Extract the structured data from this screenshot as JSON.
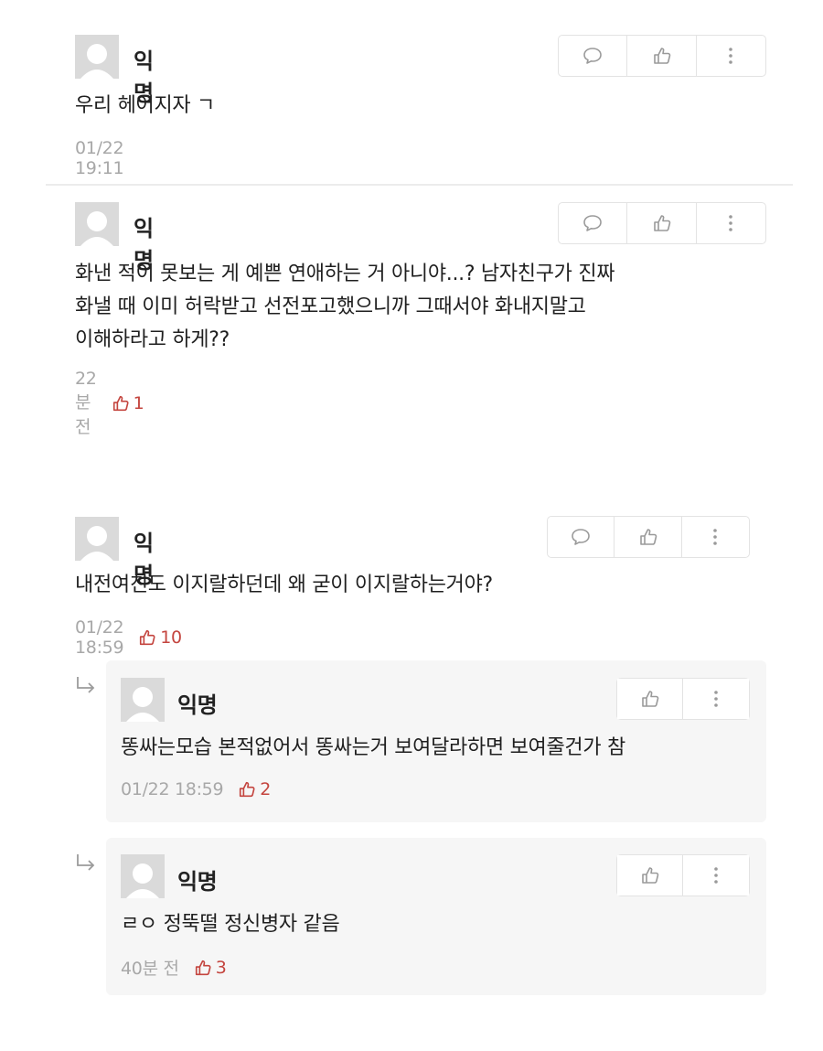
{
  "comments": [
    {
      "author": "익명",
      "lines": [
        "우리 헤어지자 ㄱ"
      ],
      "meta": "01/22 19:11",
      "likes": null
    },
    {
      "author": "익명",
      "lines": [
        "화낸 적이 못보는 게 예쁜 연애하는 거 아니야...? 남자친구가 진짜",
        "화낼 때 이미 허락받고 선전포고했으니까 그때서야 화내지말고",
        "이해하라고 하게??"
      ],
      "meta": "22분 전",
      "likes": "1"
    },
    {
      "author": "익명",
      "lines": [
        "내전여친도 이지랄하던데 왜 굳이 이지랄하는거야?"
      ],
      "meta": "01/22 18:59",
      "likes": "10"
    }
  ],
  "replies": [
    {
      "author": "익명",
      "lines": [
        "똥싸는모습 본적없어서 똥싸는거 보여달라하면 보여줄건가 참"
      ],
      "meta": "01/22 18:59",
      "likes": "2"
    },
    {
      "author": "익명",
      "lines": [
        "ㄹㅇ 정뚝떨 정신병자 같음"
      ],
      "meta": "40분 전",
      "likes": "3"
    }
  ],
  "icons": {
    "comment": "speech-bubble-icon",
    "like": "thumbs-up-icon",
    "more": "vertical-dots-icon",
    "reply": "reply-arrow-icon"
  },
  "colors": {
    "like_accent": "#c4453f",
    "meta_gray": "#a8a8a8",
    "reply_bg": "#f6f6f6"
  }
}
